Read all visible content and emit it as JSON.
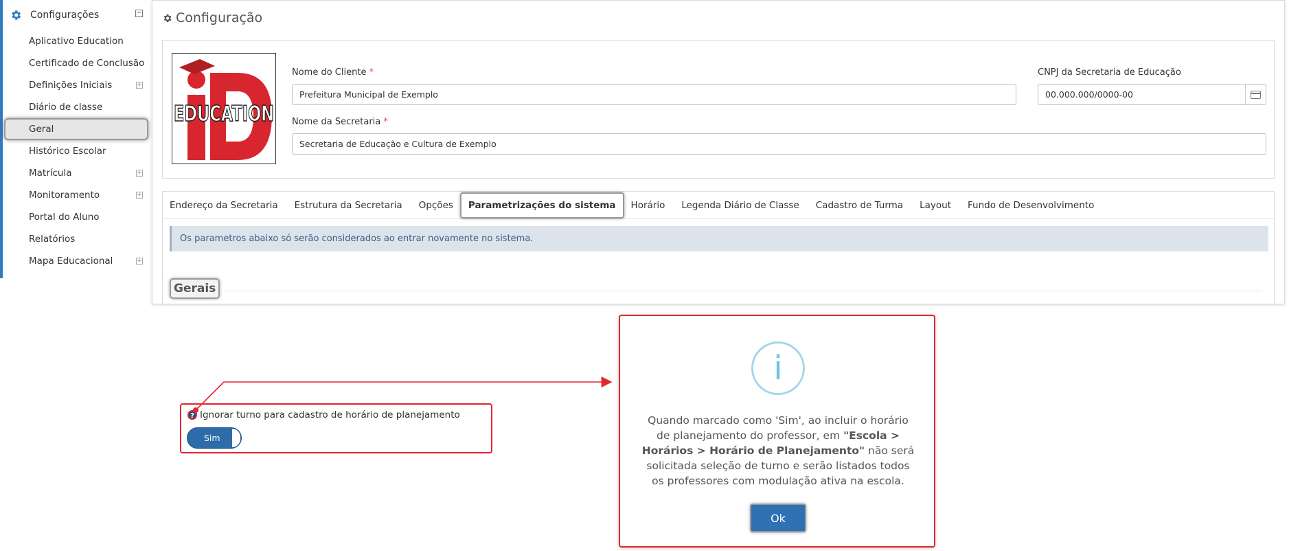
{
  "sidebar": {
    "header": "Configurações",
    "items": [
      {
        "label": "Aplicativo Education"
      },
      {
        "label": "Certificado de Conclusão"
      },
      {
        "label": "Definições Iniciais"
      },
      {
        "label": "Diário de classe"
      },
      {
        "label": "Geral"
      },
      {
        "label": "Histórico Escolar"
      },
      {
        "label": "Matrícula"
      },
      {
        "label": "Monitoramento"
      },
      {
        "label": "Portal do Aluno"
      },
      {
        "label": "Relatórios"
      },
      {
        "label": "Mapa Educacional"
      }
    ],
    "active": "Geral"
  },
  "page": {
    "title": "Configuração"
  },
  "form": {
    "client_name_label": "Nome do Cliente",
    "client_name_value": "Prefeitura Municipal de Exemplo",
    "cnpj_label": "CNPJ da Secretaria de Educação",
    "cnpj_value": "00.000.000/0000-00",
    "secretaria_label": "Nome da Secretaria",
    "secretaria_value": "Secretaria de Educação e Cultura de Exemplo",
    "required_mark": "*"
  },
  "logo": {
    "text": "EDUCATION",
    "letters": "iD"
  },
  "tabs": [
    {
      "label": "Endereço da Secretaria"
    },
    {
      "label": "Estrutura da Secretaria"
    },
    {
      "label": "Opções"
    },
    {
      "label": "Parametrizações do sistema"
    },
    {
      "label": "Horário"
    },
    {
      "label": "Legenda Diário de Classe"
    },
    {
      "label": "Cadastro de Turma"
    },
    {
      "label": "Layout"
    },
    {
      "label": "Fundo de Desenvolvimento"
    }
  ],
  "active_tab": "Parametrizações do sistema",
  "info_bar": "Os parametros abaixo só serão considerados ao entrar novamente no sistema.",
  "section": {
    "title": "Gerais"
  },
  "option": {
    "help_icon": "?",
    "label": "Ignorar turno para cadastro de horário de planejamento",
    "toggle_value": "Sim"
  },
  "dialog": {
    "icon": "i",
    "text_part1": "Quando marcado como 'Sim', ao incluir o horário de planejamento do professor, em ",
    "text_bold": "\"Escola > Horários > Horário de Planejamento\"",
    "text_part2": " não será solicitada seleção de turno e serão listados todos os professores com modulação ativa na escola.",
    "ok_label": "Ok"
  },
  "colors": {
    "accent": "#2d6ca8",
    "highlight_red": "#e0262e",
    "info_icon": "#6fc2e3",
    "sidebar_border": "#2e7bbf"
  }
}
